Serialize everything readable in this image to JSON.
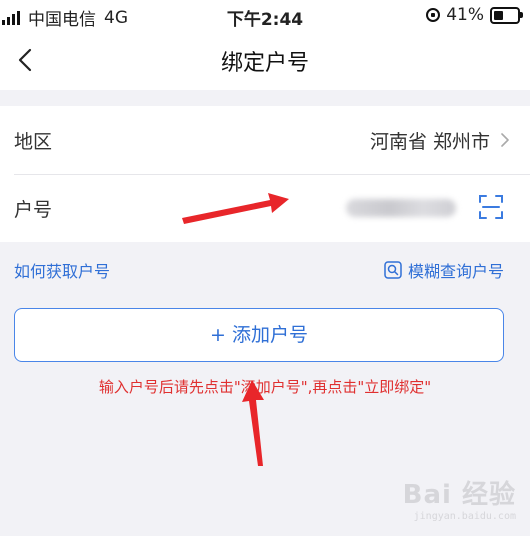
{
  "status_bar": {
    "carrier": "中国电信",
    "network": "4G",
    "time": "下午2:44",
    "battery_percent": "41%",
    "battery_level": 0.41
  },
  "nav": {
    "back_icon": "chevron-left-icon",
    "title": "绑定户号"
  },
  "form": {
    "region_label": "地区",
    "region_value": "河南省 郑州市",
    "account_label": "户号"
  },
  "links": {
    "help": "如何获取户号",
    "fuzzy_search": "模糊查询户号"
  },
  "add_button_label": "+ 添加户号",
  "tip": "输入户号后请先点击\"添加户号\",再点击\"立即绑定\"",
  "watermark": {
    "brand": "Bai 经验",
    "sub": "jingyan.baidu.com"
  },
  "colors": {
    "accent": "#2f6fd6",
    "tip": "#e03030",
    "annotation_arrow": "#e8262a"
  }
}
